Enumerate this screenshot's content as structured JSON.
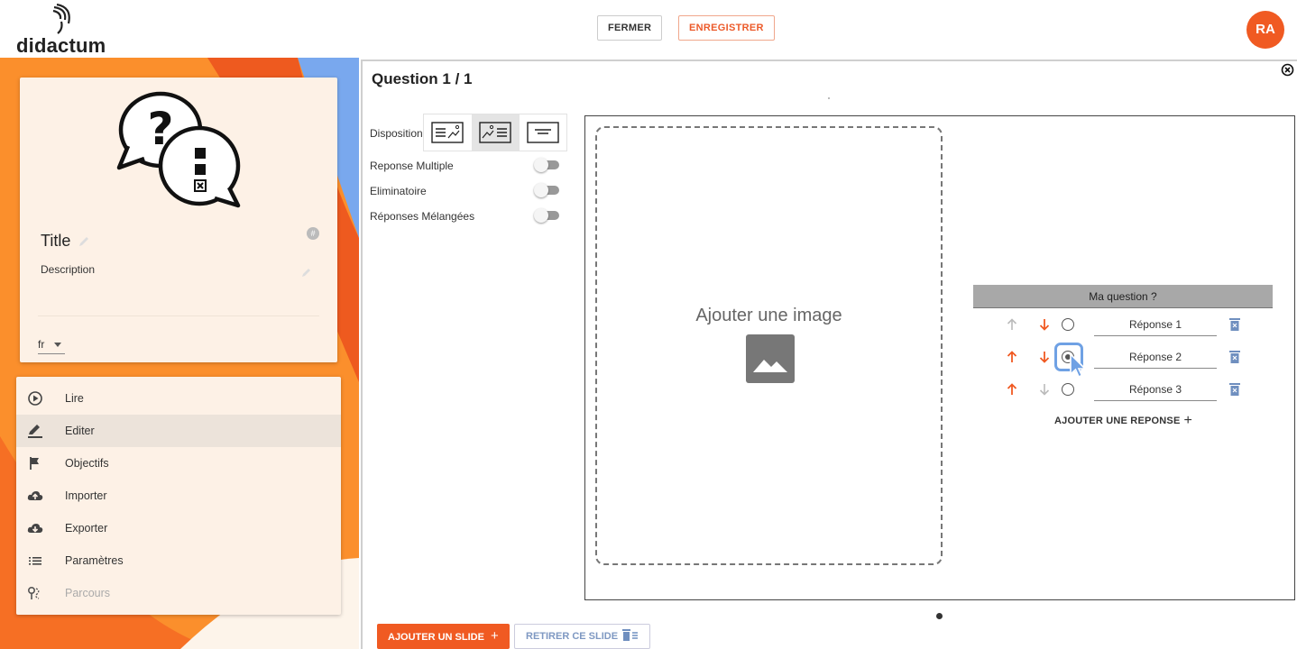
{
  "header": {
    "brand": "didactum",
    "close_label": "FERMER",
    "save_label": "ENREGISTRER",
    "avatar_initials": "RA"
  },
  "course_card": {
    "title": "Title",
    "hash_badge": "#",
    "description_label": "Description",
    "language": "fr"
  },
  "menu": {
    "items": [
      {
        "label": "Lire",
        "icon": "play-circle-icon"
      },
      {
        "label": "Editer",
        "icon": "pencil-icon"
      },
      {
        "label": "Objectifs",
        "icon": "flag-icon"
      },
      {
        "label": "Importer",
        "icon": "cloud-upload-icon"
      },
      {
        "label": "Exporter",
        "icon": "cloud-download-icon"
      },
      {
        "label": "Paramètres",
        "icon": "list-icon"
      },
      {
        "label": "Parcours",
        "icon": "route-icon"
      }
    ],
    "active": "Editer",
    "disabled": "Parcours"
  },
  "editor": {
    "question_title": "Question 1 / 1",
    "disposition_label": "Disposition",
    "disposition_selected": 2,
    "options": [
      {
        "label": "Reponse Multiple",
        "enabled": false
      },
      {
        "label": "Eliminatoire",
        "enabled": false
      },
      {
        "label": "Réponses Mélangées",
        "enabled": false
      }
    ],
    "image_placeholder": "Ajouter une image",
    "question_text": "Ma question ?",
    "answers": [
      {
        "label": "Réponse 1",
        "checked": false
      },
      {
        "label": "Réponse 2",
        "checked": true
      },
      {
        "label": "Réponse 3",
        "checked": false
      }
    ],
    "add_answer_label": "AJOUTER UNE REPONSE",
    "add_slide_label": "AJOUTER UN SLIDE",
    "remove_slide_label": "RETIRER CE SLIDE"
  },
  "colors": {
    "accent": "#f05a22",
    "panel_orange": "#fb8f2c",
    "panel_blue": "#6fa1e4"
  }
}
